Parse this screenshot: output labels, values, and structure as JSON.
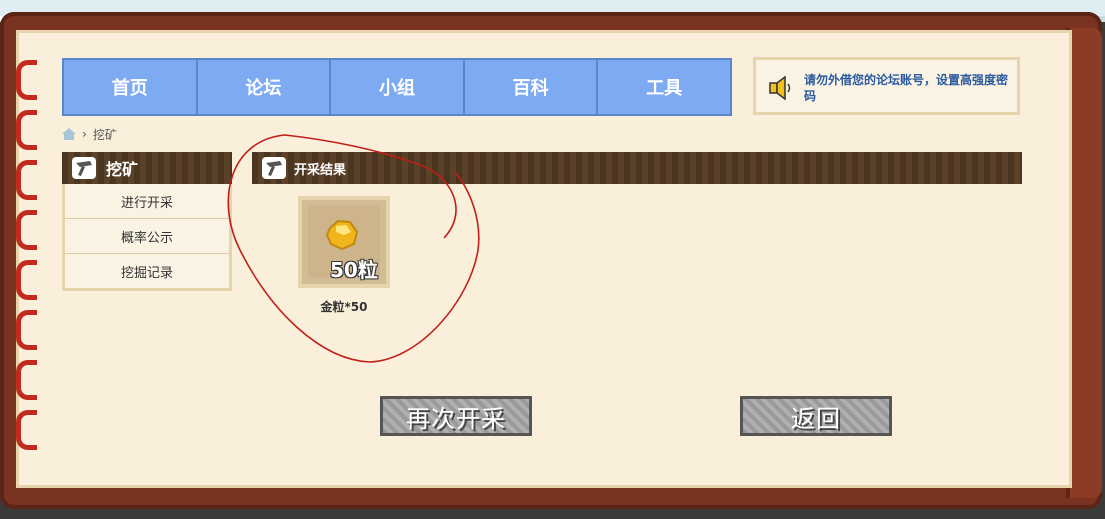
{
  "nav": {
    "items": [
      {
        "label": "首页"
      },
      {
        "label": "论坛"
      },
      {
        "label": "小组"
      },
      {
        "label": "百科"
      },
      {
        "label": "工具"
      }
    ]
  },
  "notice": {
    "text": "请勿外借您的论坛账号，设置高强度密码",
    "icon": "speaker-icon"
  },
  "breadcrumb": {
    "current": "挖矿",
    "home_icon": "home-icon"
  },
  "sidebar": {
    "title": "挖矿",
    "items": [
      {
        "label": "进行开采"
      },
      {
        "label": "概率公示"
      },
      {
        "label": "挖掘记录"
      }
    ]
  },
  "main": {
    "title": "开采结果",
    "result": {
      "qty_label": "50粒",
      "name": "金粒*50",
      "icon": "gold-nugget-icon"
    }
  },
  "buttons": {
    "mine_again": "再次开采",
    "back": "返回"
  },
  "colors": {
    "nav_bg": "#7eaaf2",
    "frame": "#7a3320",
    "page_bg": "#f9efda",
    "annotation": "#c0201a"
  }
}
